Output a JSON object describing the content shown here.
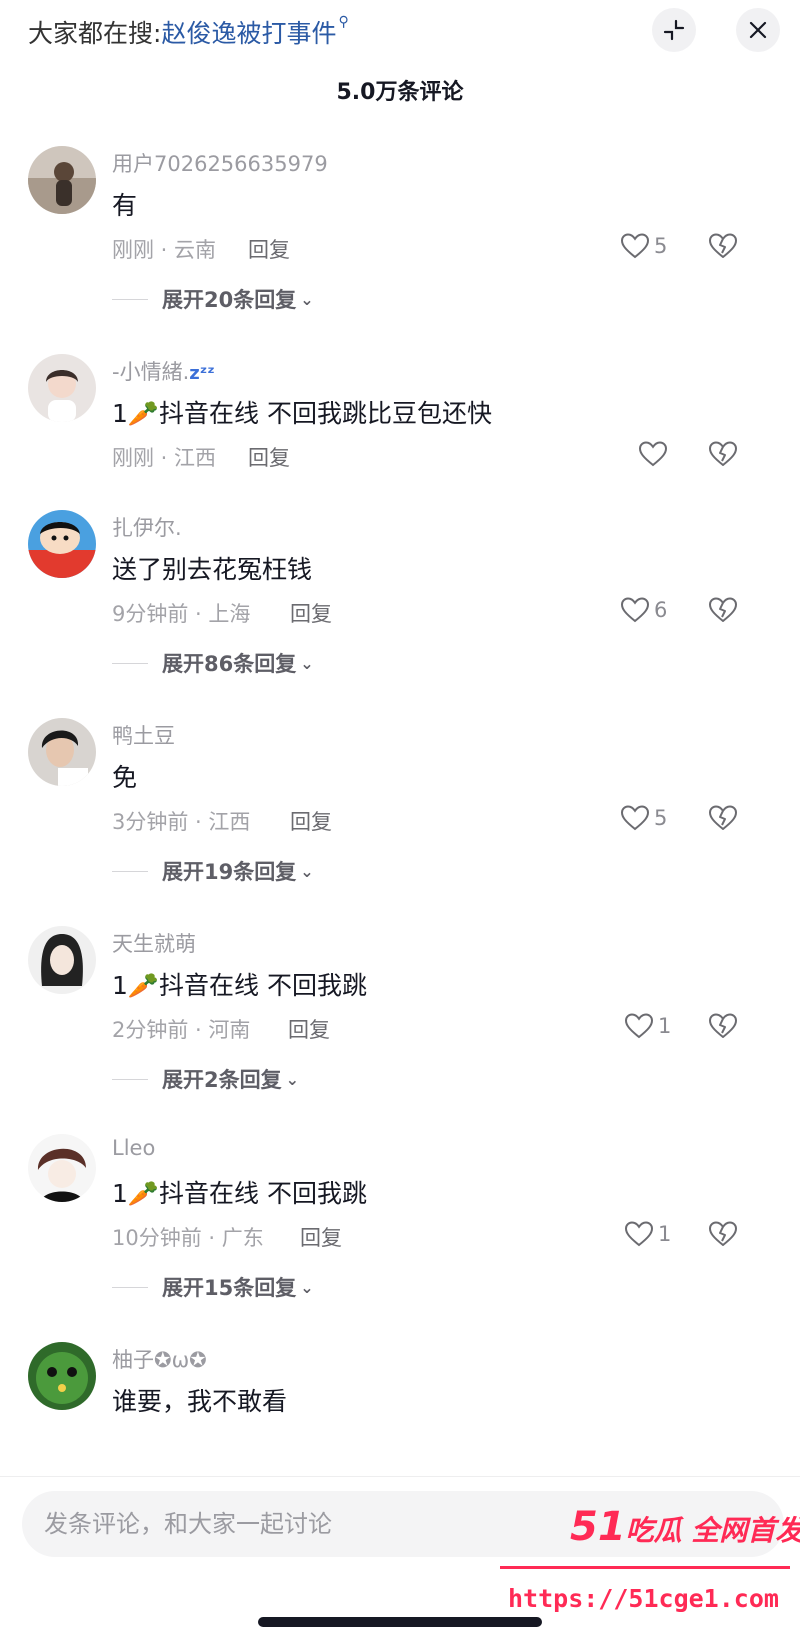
{
  "header": {
    "search_prefix": "大家都在搜:",
    "search_term": "赵俊逸被打事件",
    "comment_count_title": "5.0万条评论"
  },
  "colors": {
    "accent_link": "#2b5aa5",
    "watermark": "#ff2a55"
  },
  "comments": [
    {
      "user": "用户7026256635979",
      "text": "有",
      "meta": "刚刚 · 云南",
      "reply": "回复",
      "likes": "5",
      "expand": "展开20条回复"
    },
    {
      "user": "-小情緒.",
      "text": "1🥕抖音在线 不回我跳比豆包还快",
      "meta": "刚刚 · 江西",
      "reply": "回复",
      "likes": "",
      "expand": ""
    },
    {
      "user": "扎伊尔.",
      "text": "送了别去花冤枉钱",
      "meta": "9分钟前 · 上海",
      "reply": "回复",
      "likes": "6",
      "expand": "展开86条回复"
    },
    {
      "user": "鸭土豆",
      "text": "免",
      "meta": "3分钟前 · 江西",
      "reply": "回复",
      "likes": "5",
      "expand": "展开19条回复"
    },
    {
      "user": "天生就萌",
      "text": "1🥕抖音在线 不回我跳",
      "meta": "2分钟前 · 河南",
      "reply": "回复",
      "likes": "1",
      "expand": "展开2条回复"
    },
    {
      "user": "Lleo",
      "text": "1🥕抖音在线 不回我跳",
      "meta": "10分钟前 · 广东",
      "reply": "回复",
      "likes": "1",
      "expand": "展开15条回复"
    },
    {
      "user": "柚子✪ω✪",
      "text": "谁要，我不敢看"
    }
  ],
  "input": {
    "placeholder": "发条评论，和大家一起讨论"
  },
  "watermark": {
    "num": "51",
    "brand": "吃瓜 全网首发",
    "url": "https://51cge1.com"
  }
}
